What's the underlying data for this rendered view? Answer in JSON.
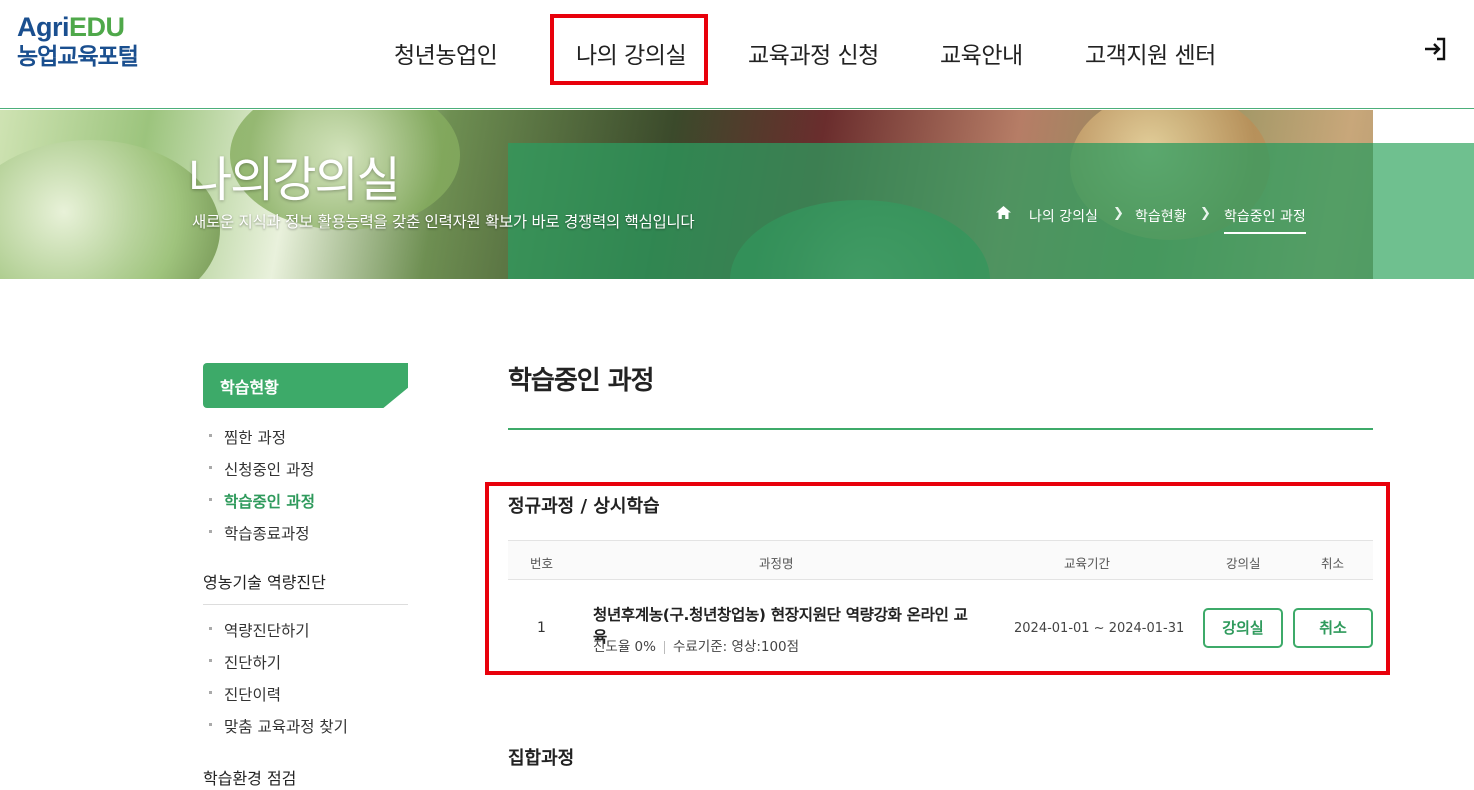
{
  "header": {
    "logo_en_a": "Agri",
    "logo_en_b": "EDU",
    "logo_kr": "농업교육포털",
    "nav": [
      "청년농업인",
      "나의 강의실",
      "교육과정 신청",
      "교육안내",
      "고객지원 센터"
    ],
    "login_icon": "login-icon"
  },
  "banner": {
    "title": "나의강의실",
    "subtitle": "새로운 지식과 정보 활용능력을 갖춘 인력자원 확보가 바로 경쟁력의 핵심입니다",
    "breadcrumb": [
      "나의 강의실",
      "학습현황",
      "학습중인 과정"
    ],
    "home_icon": "home-icon"
  },
  "sidebar": {
    "header": "학습현황",
    "group1": [
      "찜한 과정",
      "신청중인 과정",
      "학습중인 과정",
      "학습종료과정"
    ],
    "group2_title": "영농기술 역량진단",
    "group2": [
      "역량진단하기",
      "진단하기",
      "진단이력",
      "맞춤 교육과정 찾기"
    ],
    "group3_title": "학습환경 점검"
  },
  "main": {
    "title": "학습중인 과정",
    "section1_title": "정규과정 / 상시학습",
    "table_headers": [
      "번호",
      "과정명",
      "교육기간",
      "강의실",
      "취소"
    ],
    "rows": [
      {
        "num": "1",
        "name": "청년후계농(구.청년창업농) 현장지원단 역량강화 온라인 교육",
        "progress": "진도율  0%",
        "criteria": "수료기준: 영상:100점",
        "period": "2024-01-01 ~ 2024-01-31",
        "btn_classroom": "강의실",
        "btn_cancel": "취소"
      }
    ],
    "section2_title": "집합과정"
  },
  "colors": {
    "accent": "#3daa69",
    "highlight": "#e8000b",
    "logo_blue": "#1a4f8f",
    "logo_green": "#4fa84a"
  }
}
